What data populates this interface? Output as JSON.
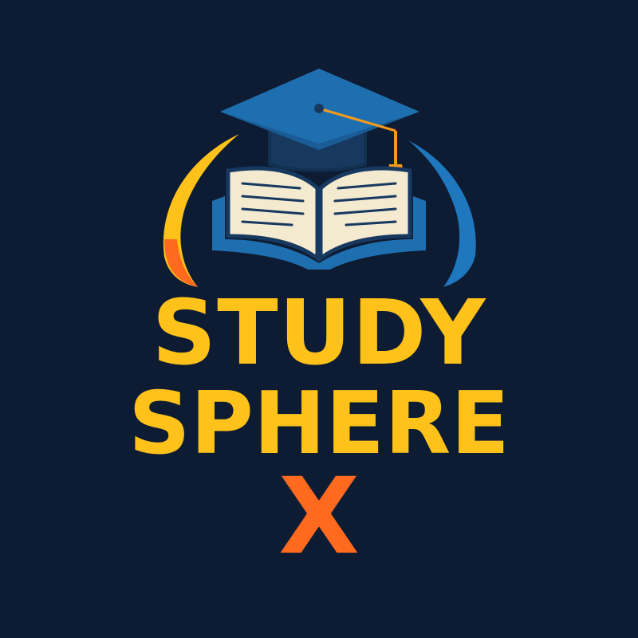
{
  "logo": {
    "line1": "STUDY",
    "line2": "SPHERE",
    "line3": "X"
  },
  "colors": {
    "background": "#0d1c33",
    "yellow": "#ffc21a",
    "orange": "#ff6a1f",
    "blue": "#1f6fb2",
    "dark_blue": "#17385f",
    "page_cream": "#f3ead0",
    "tassel": "#f39a1a"
  },
  "icons": {
    "cap": "graduation-cap-icon",
    "book": "open-book-icon",
    "left_arc": "yellow-arc",
    "right_arc": "blue-arc"
  }
}
